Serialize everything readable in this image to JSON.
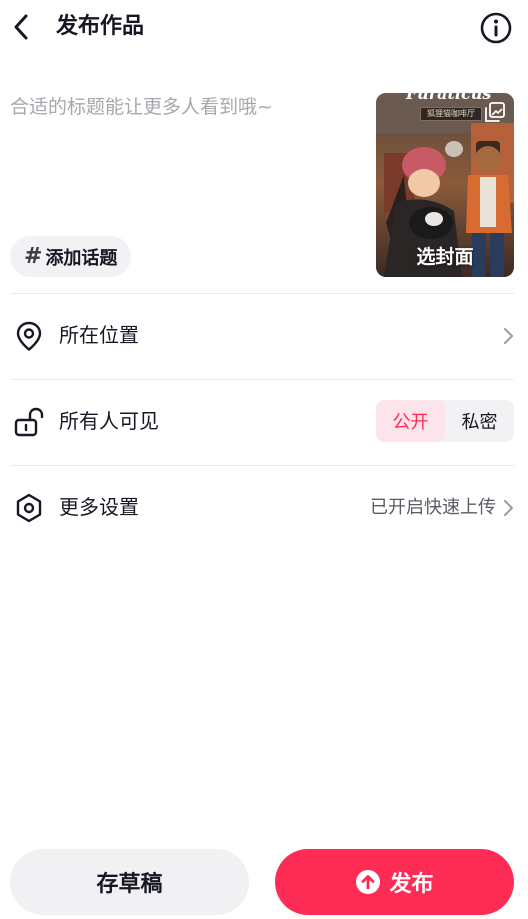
{
  "header": {
    "title": "发布作品",
    "back_icon": "chevron-left-icon",
    "info_icon": "info-circle-icon"
  },
  "editor": {
    "caption_placeholder": "合适的标题能让更多人看到哦~",
    "topic_hash": "#",
    "topic_label": "添加话题"
  },
  "cover": {
    "label": "选封面",
    "sign_text": "狐狸猫咖啡厅",
    "album_icon": "image-stack-icon"
  },
  "rows": {
    "location": {
      "icon": "location-pin-icon",
      "label": "所在位置"
    },
    "visibility": {
      "icon": "unlock-icon",
      "label": "所有人可见",
      "options": [
        "公开",
        "私密"
      ],
      "selected": "公开"
    },
    "more": {
      "icon": "hexagon-settings-icon",
      "label": "更多设置",
      "value": "已开启快速上传"
    }
  },
  "footer": {
    "draft_label": "存草稿",
    "publish_label": "发布",
    "publish_icon": "arrow-up-circle-icon"
  },
  "colors": {
    "accent": "#fe2c55",
    "accent_soft": "#fde3ea",
    "text": "#161823",
    "placeholder": "#a7a8ad"
  }
}
